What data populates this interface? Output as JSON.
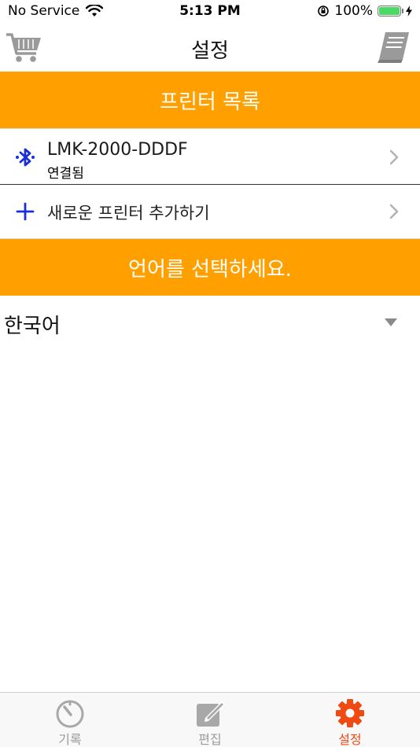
{
  "status_bar": {
    "carrier": "No Service",
    "time": "5:13 PM",
    "battery": "100%",
    "battery_level": 1.0
  },
  "nav": {
    "title": "설정",
    "left_icon": "cart-icon",
    "right_icon": "manual-book-icon"
  },
  "printer_section": {
    "header": "프린터 목록",
    "printer": {
      "name": "LMK-2000-DDDF",
      "status": "연결됨",
      "icon": "bluetooth-icon"
    },
    "add_printer_label": "새로운 프린터 추가하기",
    "add_icon": "plus-icon"
  },
  "language_section": {
    "header": "언어를 선택하세요.",
    "selected_language": "한국어"
  },
  "tabs": [
    {
      "label": "기록",
      "icon": "timer-icon",
      "active": false
    },
    {
      "label": "편집",
      "icon": "edit-icon",
      "active": false
    },
    {
      "label": "설정",
      "icon": "gear-icon",
      "active": true
    }
  ],
  "colors": {
    "accent_orange": "#ffa000",
    "active_tab": "#ef4a12",
    "inactive_tab": "#9b9b9b",
    "bluetooth_blue": "#1a2ed8",
    "battery_green": "#4cd964"
  }
}
